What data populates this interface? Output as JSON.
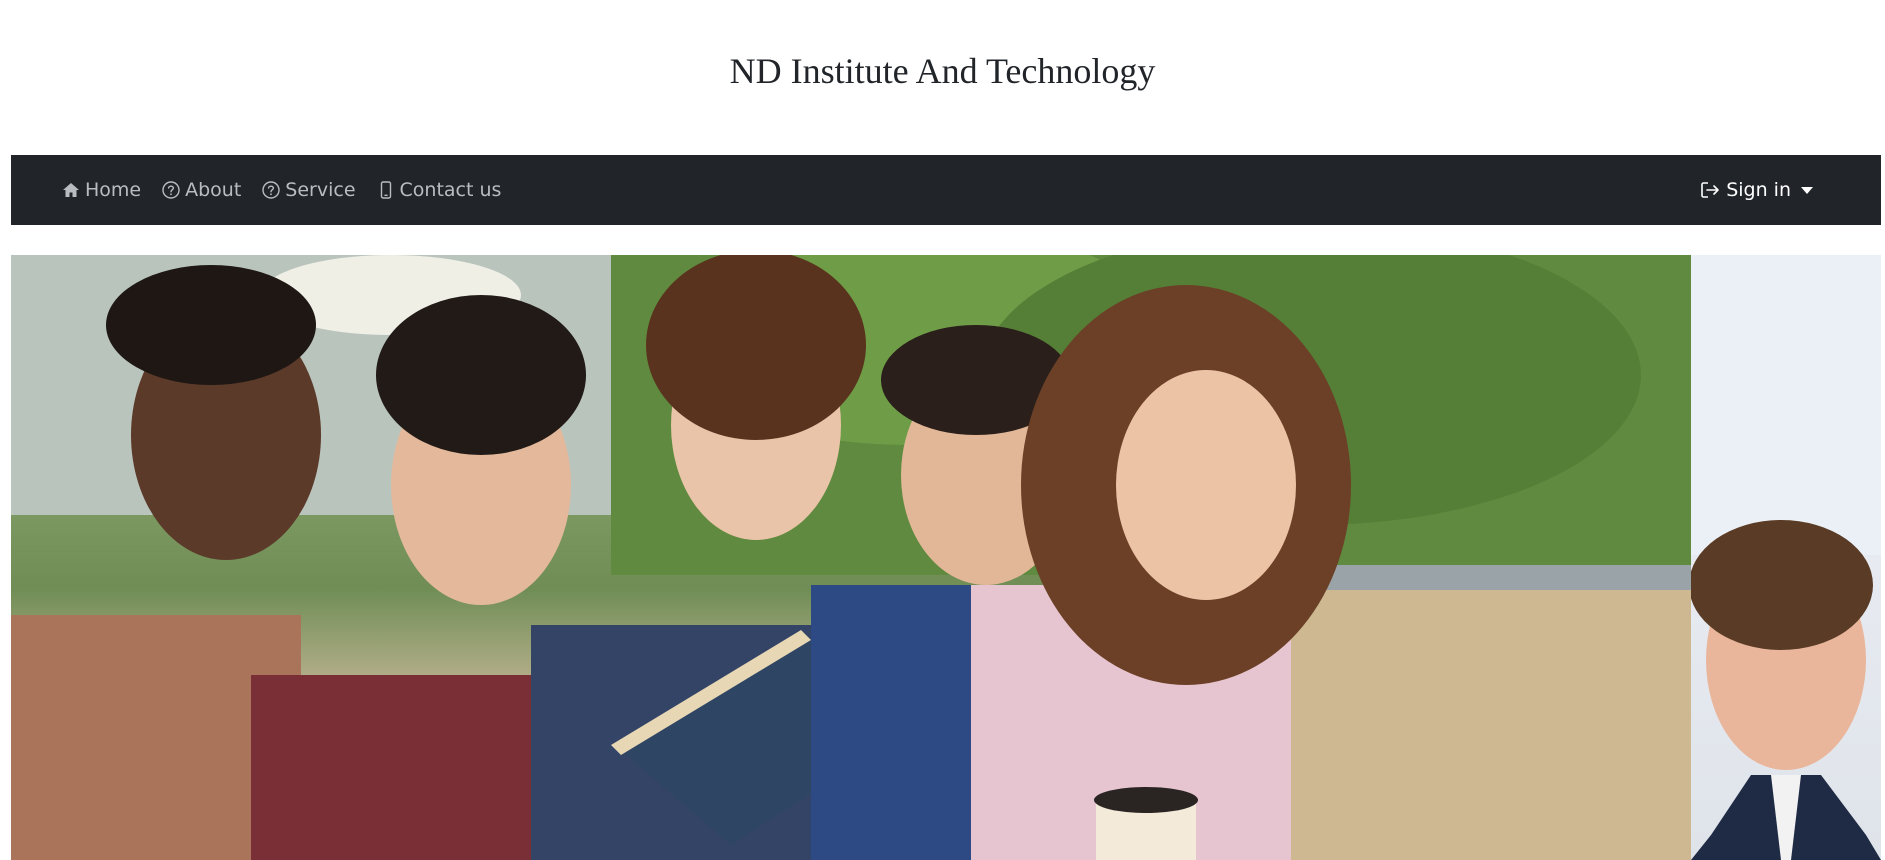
{
  "site": {
    "title": "ND Institute And Technology"
  },
  "navbar": {
    "links": [
      {
        "label": "Home",
        "icon": "home-icon"
      },
      {
        "label": "About",
        "icon": "question-circle-icon"
      },
      {
        "label": "Service",
        "icon": "question-circle-icon"
      },
      {
        "label": "Contact us",
        "icon": "phone-icon"
      }
    ],
    "signin": {
      "label": "Sign in",
      "icon": "sign-in-icon"
    }
  },
  "carousel": {
    "slides": [
      {
        "alt": "students-reading-book"
      },
      {
        "alt": "smiling-man-in-suit"
      }
    ]
  },
  "colors": {
    "navbar_bg": "#212529",
    "nav_link": "#b9bdc2",
    "signin": "#ffffff",
    "title": "#212529"
  }
}
